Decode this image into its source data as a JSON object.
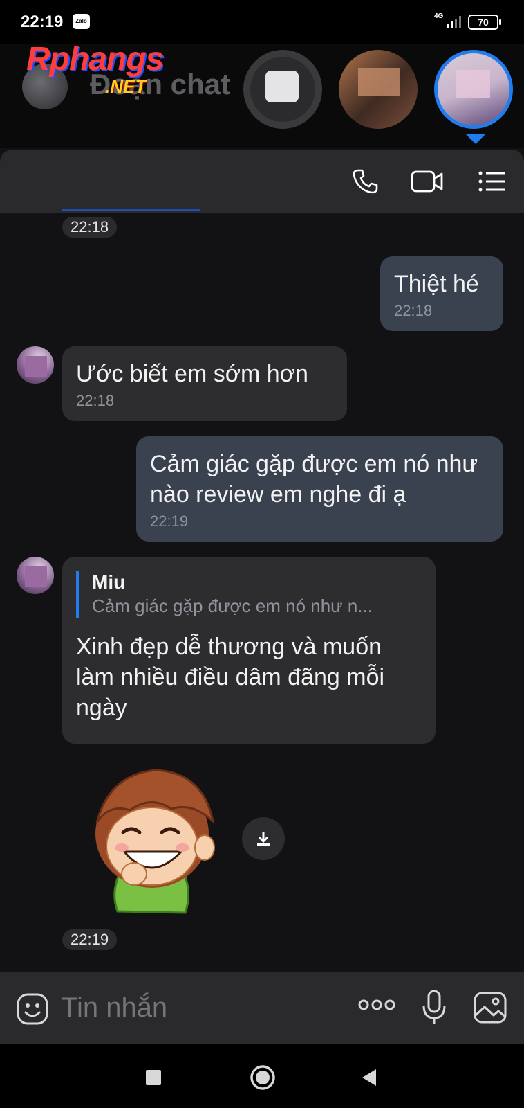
{
  "status_bar": {
    "time": "22:19",
    "app_badge": "Zalo",
    "network": "4G",
    "battery": "70"
  },
  "background_header": {
    "title": "Đoạn chat",
    "watermark_main": "Rphangs",
    "watermark_suffix": ".NET"
  },
  "chat_header": {
    "icons": [
      "phone-icon",
      "video-call-icon",
      "menu-list-icon"
    ]
  },
  "messages": [
    {
      "type": "time_pill",
      "text": "22:18"
    },
    {
      "type": "outgoing",
      "text": "Thiệt hé",
      "time": "22:18"
    },
    {
      "type": "incoming",
      "text": "Ước biết em sớm hơn",
      "time": "22:18"
    },
    {
      "type": "outgoing",
      "text": "Cảm giác gặp được em nó như nào review em nghe đi ạ",
      "time": "22:19"
    },
    {
      "type": "incoming_reply",
      "reply_name": "Miu",
      "reply_text": "Cảm giác gặp được em nó như n...",
      "text": "Xinh đẹp dễ thương và muốn làm nhiều điều dâm đãng mỗi ngày"
    },
    {
      "type": "sticker",
      "icon": "boy-grinning-sticker"
    },
    {
      "type": "time_pill",
      "text": "22:19"
    }
  ],
  "input_bar": {
    "placeholder": "Tin nhắn",
    "icons": [
      "emoji-icon",
      "more-icon",
      "microphone-icon",
      "image-icon"
    ]
  },
  "colors": {
    "accent": "#1f7df0",
    "outgoing_bubble": "#3a4250",
    "incoming_bubble": "#2d2d30",
    "background": "#121214"
  }
}
